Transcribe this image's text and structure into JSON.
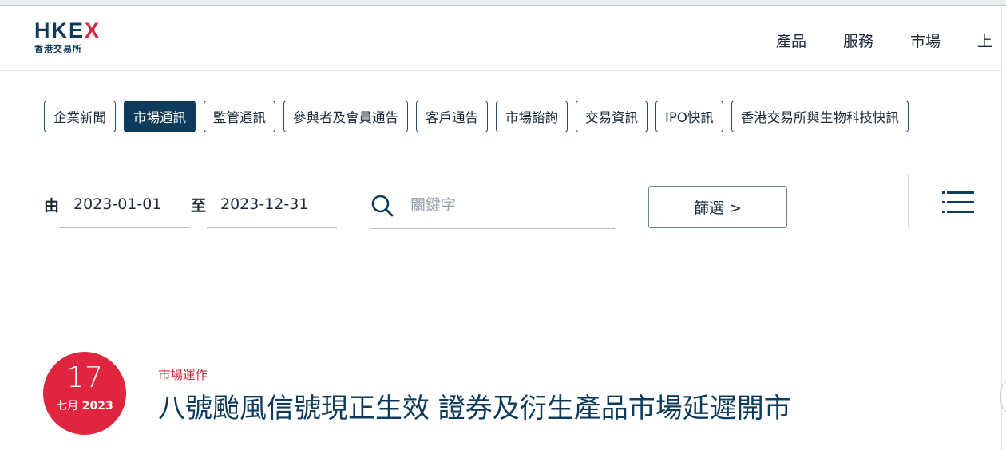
{
  "header": {
    "logo": {
      "main": "HKEX",
      "sub": "香港交易所"
    },
    "nav": [
      "產品",
      "服務",
      "市場",
      "上"
    ]
  },
  "tabs": [
    {
      "label": "企業新聞",
      "active": false
    },
    {
      "label": "市場通訊",
      "active": true
    },
    {
      "label": "監管通訊",
      "active": false
    },
    {
      "label": "參與者及會員通告",
      "active": false
    },
    {
      "label": "客戶通告",
      "active": false
    },
    {
      "label": "市場諮詢",
      "active": false
    },
    {
      "label": "交易資訊",
      "active": false
    },
    {
      "label": "IPO快訊",
      "active": false
    },
    {
      "label": "香港交易所與生物科技快訊",
      "active": false
    }
  ],
  "filters": {
    "from_label": "由",
    "from_value": "2023-01-01",
    "to_label": "至",
    "to_value": "2023-12-31",
    "search_placeholder": "關鍵字",
    "filter_button": "篩選 >"
  },
  "icons": {
    "search": "search-icon",
    "menu": "hamburger-menu-icon"
  },
  "news": {
    "day": "17",
    "month": "七月",
    "year": "2023",
    "category": "市場運作",
    "title": "八號颱風信號現正生效 證券及衍生產品市場延遲開市"
  },
  "colors": {
    "brand_navy": "#0e3a5c",
    "accent_red": "#e0253f"
  }
}
